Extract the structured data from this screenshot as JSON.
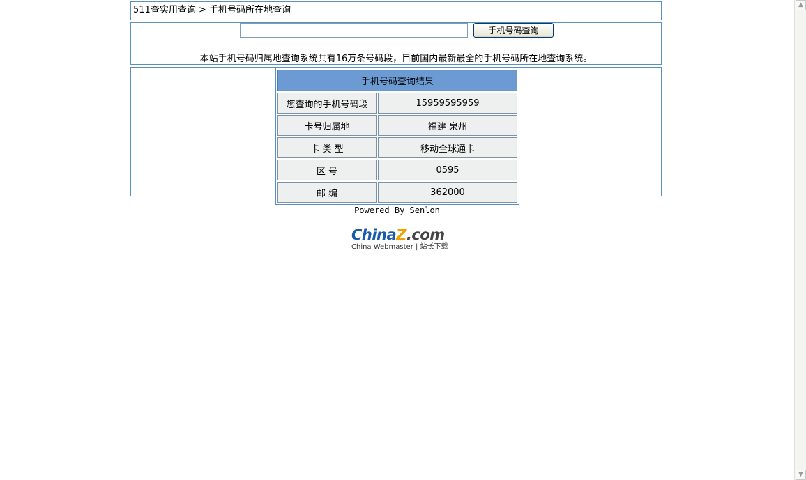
{
  "breadcrumb": {
    "site": "511查实用查询",
    "separator": " > ",
    "current": "手机号码所在地查询"
  },
  "search": {
    "input_value": "",
    "button_label": "手机号码查询"
  },
  "notice": "本站手机号码归属地查询系统共有16万条号码段，目前国内最新最全的手机号码所在地查询系统。",
  "result": {
    "title": "手机号码查询结果",
    "rows": [
      {
        "label": "您查询的手机号码段",
        "value": "15959595959"
      },
      {
        "label": "卡号归属地",
        "value": "福建 泉州"
      },
      {
        "label": "卡 类 型",
        "value": "移动全球通卡"
      },
      {
        "label": "区 号",
        "value": "0595"
      },
      {
        "label": "邮 编",
        "value": "362000"
      }
    ]
  },
  "footer": {
    "powered": "Powered By Senlon",
    "logo_main_prefix": "China",
    "logo_main_z": "Z",
    "logo_main_suffix": ".com",
    "logo_sub": "China Webmaster | 站长下载"
  },
  "scrollbar": {
    "up_icon": "▲",
    "down_icon": "▼"
  }
}
